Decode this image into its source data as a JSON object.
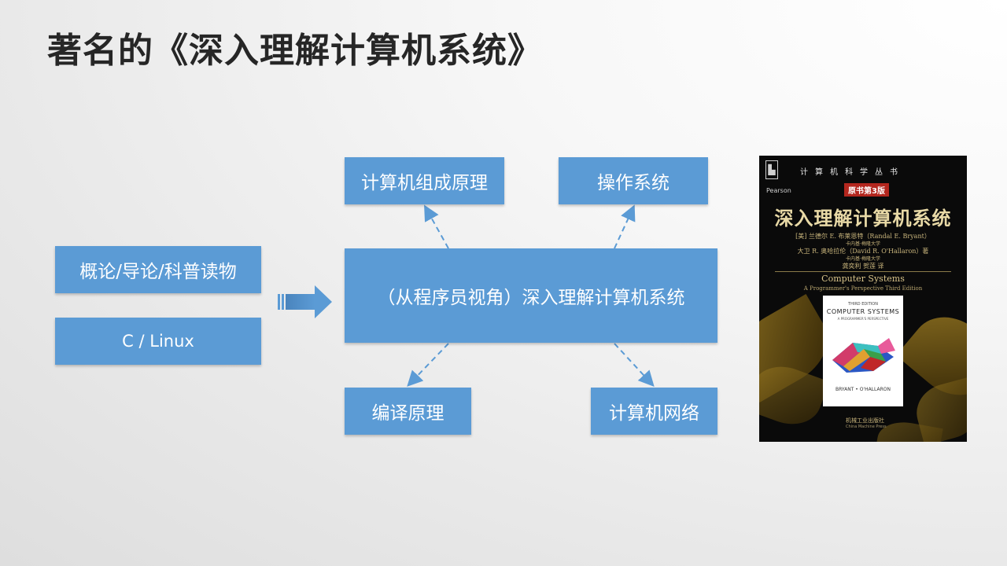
{
  "slide": {
    "title": "著名的《深入理解计算机系统》"
  },
  "diagram": {
    "left_boxes": [
      {
        "label": "概论/导论/科普读物"
      },
      {
        "label": "C / Linux"
      }
    ],
    "center_box": {
      "label": "（从程序员视角）深入理解计算机系统"
    },
    "branch_boxes": {
      "top_left": {
        "label": "计算机组成原理"
      },
      "top_right": {
        "label": "操作系统"
      },
      "bottom_left": {
        "label": "编译原理"
      },
      "bottom_right": {
        "label": "计算机网络"
      }
    },
    "colors": {
      "box_fill": "#5b9bd5",
      "box_text": "#ffffff",
      "arrow": "#5b9bd5"
    }
  },
  "book_cover": {
    "series": "计算机科学丛书",
    "edition_badge": "原书第3版",
    "publisher_logo": "Pearson",
    "title_cn": "深入理解计算机系统",
    "author1": "[美] 兰德尔 E. 布莱恩特（Randal E. Bryant）",
    "author1_affil": "卡内基·梅隆大学",
    "author2": "大卫 R. 奥哈拉伦（David R. O'Hallaron）著",
    "author2_affil": "卡内基·梅隆大学",
    "translators": "龚奕利 贺莲 译",
    "title_en": "Computer Systems",
    "subtitle_en": "A Programmer's Perspective  Third Edition",
    "inner_edition": "THIRD EDITION",
    "inner_title": "COMPUTER SYSTEMS",
    "inner_subtitle": "A PROGRAMMER'S PERSPECTIVE",
    "inner_authors": "BRYANT • O'HALLARON",
    "publisher": "机械工业出版社",
    "publisher_en": "China Machine Press"
  }
}
